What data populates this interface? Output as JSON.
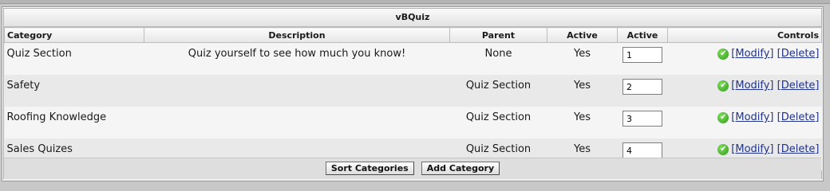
{
  "panel": {
    "title": "vBQuiz"
  },
  "table": {
    "headers": {
      "category": "Category",
      "description": "Description",
      "parent": "Parent",
      "active": "Active",
      "order": "Active",
      "controls": "Controls"
    },
    "rows": [
      {
        "category": "Quiz Section",
        "description": "Quiz yourself to see how much you know!",
        "parent": "None",
        "active": "Yes",
        "order": "1",
        "modify": "[Modify]",
        "delete": "[Delete]"
      },
      {
        "category": "Safety",
        "description": "",
        "parent": "Quiz Section",
        "active": "Yes",
        "order": "2",
        "modify": "[Modify]",
        "delete": "[Delete]"
      },
      {
        "category": "Roofing Knowledge",
        "description": "",
        "parent": "Quiz Section",
        "active": "Yes",
        "order": "3",
        "modify": "[Modify]",
        "delete": "[Delete]"
      },
      {
        "category": "Sales Quizes",
        "description": "",
        "parent": "Quiz Section",
        "active": "Yes",
        "order": "4",
        "modify": "[Modify]",
        "delete": "[Delete]"
      }
    ]
  },
  "footer": {
    "sort_label": "Sort Categories",
    "add_label": "Add Category"
  },
  "icons": {
    "status": "check-circle-icon"
  },
  "colors": {
    "link": "#22338a",
    "status_ok": "#3aa81f"
  }
}
